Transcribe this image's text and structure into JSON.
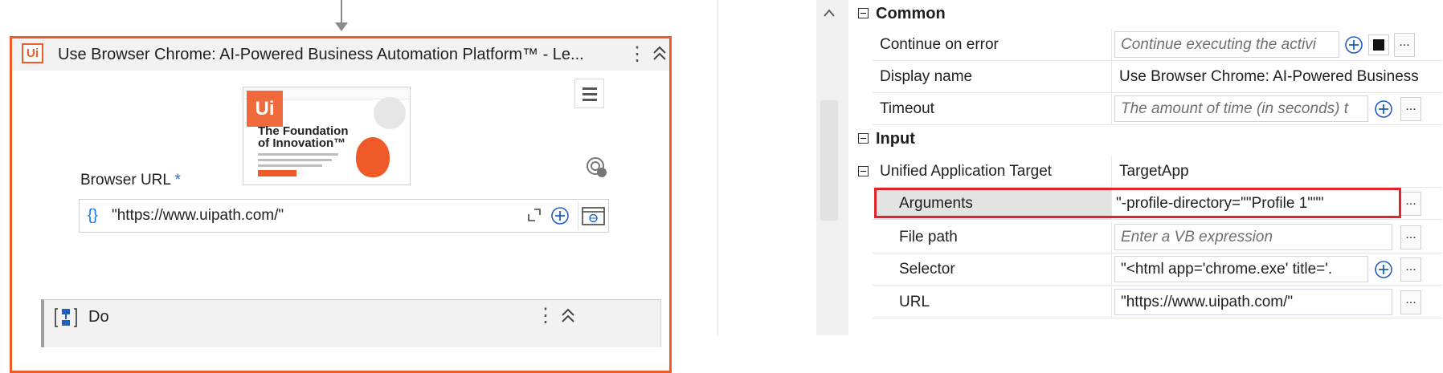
{
  "designer": {
    "activity_logo": "Ui",
    "activity_title": "Use Browser Chrome: AI-Powered Business Automation Platform™ - Le...",
    "kebab_label": "⋮",
    "thumbnail": {
      "logo": "Ui",
      "headline": "The Foundation of Innovation™"
    },
    "browser_url": {
      "label": "Browser URL",
      "required_mark": "*",
      "braces": "{}",
      "value": "\"https://www.uipath.com/\""
    },
    "do_block": {
      "label": "Do",
      "kebab_label": "⋮"
    }
  },
  "properties": {
    "categories": {
      "common": "Common",
      "input": "Input"
    },
    "ellipsis_label": "...",
    "continue_on_error": {
      "name": "Continue on error",
      "placeholder": "Continue executing the activi"
    },
    "display_name": {
      "name": "Display name",
      "value": "Use Browser Chrome: AI-Powered Business"
    },
    "timeout": {
      "name": "Timeout",
      "placeholder": "The amount of time (in seconds) t"
    },
    "unified_target": {
      "name": "Unified Application Target",
      "value": "TargetApp"
    },
    "arguments": {
      "name": "Arguments",
      "value": "\"-profile-directory=\"\"Profile 1\"\"\""
    },
    "file_path": {
      "name": "File path",
      "placeholder": "Enter a VB expression"
    },
    "selector": {
      "name": "Selector",
      "value": "\"<html app='chrome.exe' title='."
    },
    "url": {
      "name": "URL",
      "value": "\"https://www.uipath.com/\""
    }
  },
  "colors": {
    "accent": "#f05a28",
    "highlight_border": "#e0242b",
    "link_blue": "#1a73e8"
  }
}
